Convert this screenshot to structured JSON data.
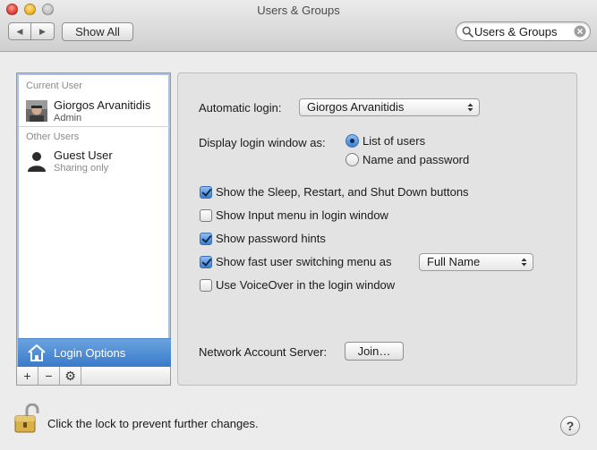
{
  "window": {
    "title": "Users & Groups"
  },
  "toolbar": {
    "back_glyph": "◀",
    "forward_glyph": "▶",
    "show_all_label": "Show All",
    "search_value": "Users & Groups",
    "search_icon": "search-icon",
    "clear_icon": "clear-icon"
  },
  "sidebar": {
    "current_user_header": "Current User",
    "current_user": {
      "name": "Giorgos Arvanitidis",
      "role": "Admin"
    },
    "other_users_header": "Other Users",
    "other_users": [
      {
        "name": "Guest User",
        "role": "Sharing only"
      }
    ],
    "login_options_label": "Login Options",
    "tools": {
      "add": "+",
      "remove": "−",
      "action": "⚙"
    }
  },
  "login_panel": {
    "automatic_login_label": "Automatic login:",
    "automatic_login_value": "Giorgos Arvanitidis",
    "display_login_label": "Display login window as:",
    "display_options": [
      {
        "label": "List of users",
        "selected": true
      },
      {
        "label": "Name and password",
        "selected": false
      }
    ],
    "checkboxes": [
      {
        "label": "Show the Sleep, Restart, and Shut Down buttons",
        "checked": true
      },
      {
        "label": "Show Input menu in login window",
        "checked": false
      },
      {
        "label": "Show password hints",
        "checked": true
      },
      {
        "label": "Show fast user switching menu as",
        "checked": true
      },
      {
        "label": "Use VoiceOver in the login window",
        "checked": false
      }
    ],
    "fast_switch_value": "Full Name",
    "network_server_label": "Network Account Server:",
    "join_label": "Join…"
  },
  "footer": {
    "lock_text": "Click the lock to prevent further changes.",
    "help_label": "?"
  },
  "colors": {
    "selection": "#3a7ac9",
    "checkbox_on": "#3c7fd0",
    "window_bg": "#ececec"
  }
}
